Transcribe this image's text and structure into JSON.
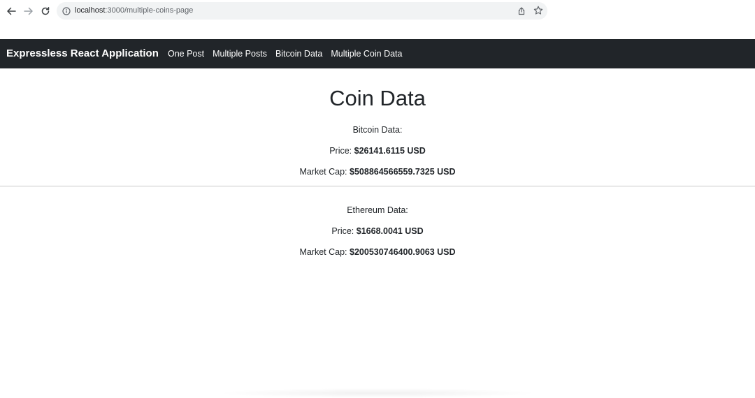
{
  "browser": {
    "url_host": "localhost",
    "url_rest": ":3000/multiple-coins-page"
  },
  "navbar": {
    "brand": "Expressless React Application",
    "links": [
      "One Post",
      "Multiple Posts",
      "Bitcoin Data",
      "Multiple Coin Data"
    ]
  },
  "page": {
    "title": "Coin Data"
  },
  "coins": [
    {
      "heading": "Bitcoin Data:",
      "price_label": "Price:",
      "price_value": "$26141.6115 USD",
      "market_cap_label": "Market Cap:",
      "market_cap_value": "$508864566559.7325 USD"
    },
    {
      "heading": "Ethereum Data:",
      "price_label": "Price:",
      "price_value": "$1668.0041 USD",
      "market_cap_label": "Market Cap:",
      "market_cap_value": "$200530746400.9063 USD"
    }
  ],
  "colors": {
    "navbar_bg": "#212529",
    "omnibox_bg": "#f1f3f4",
    "text": "#212529"
  },
  "icons": {
    "back": "back-arrow-icon",
    "forward": "forward-arrow-icon",
    "reload": "reload-icon",
    "site_info": "info-icon",
    "share": "share-icon",
    "bookmark": "star-icon"
  }
}
